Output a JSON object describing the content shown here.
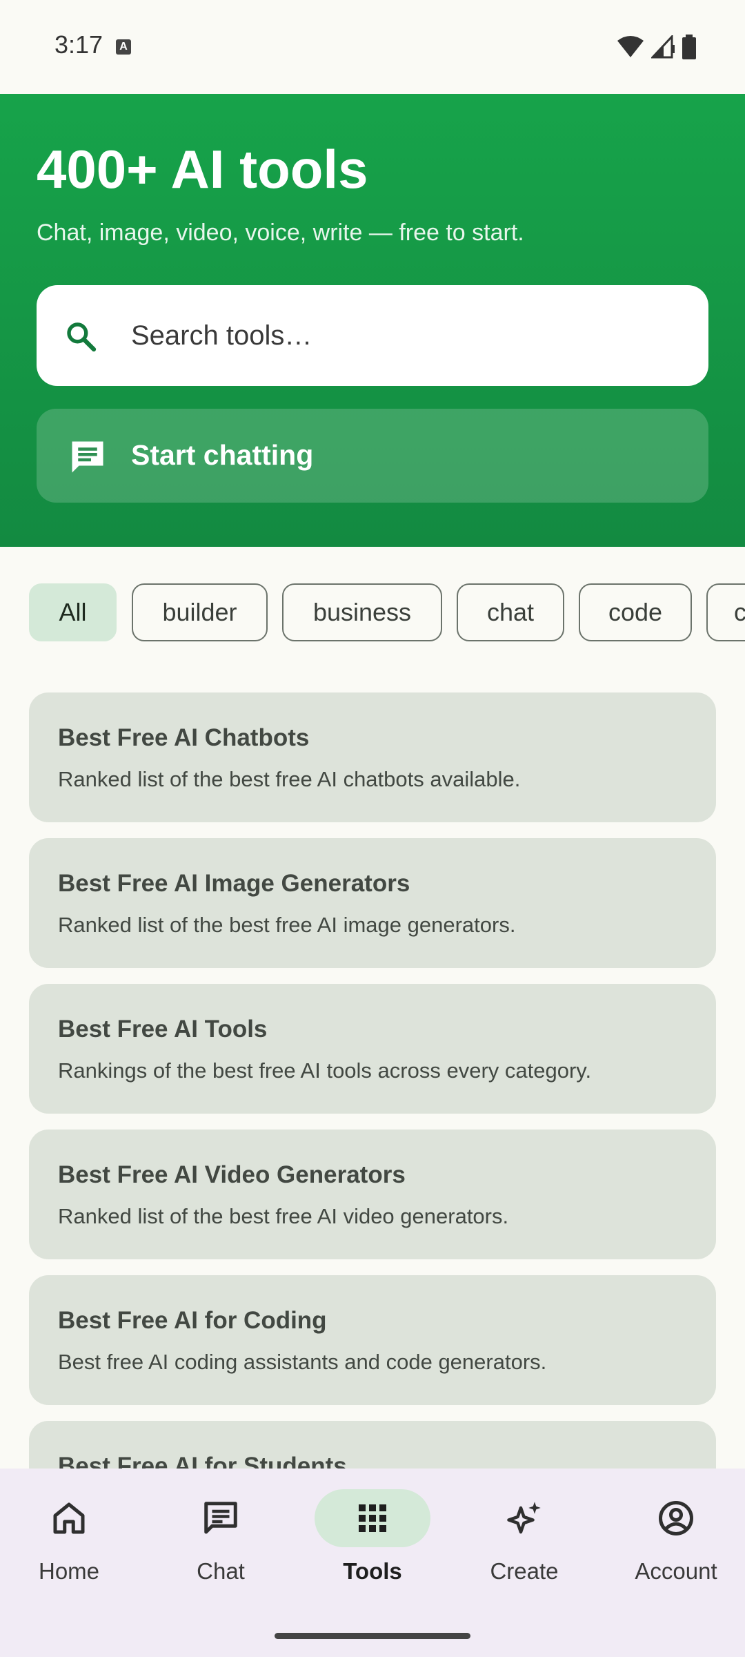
{
  "status_bar": {
    "time": "3:17",
    "notification_letter": "A"
  },
  "hero": {
    "title": "400+ AI tools",
    "subtitle": "Chat, image, video, voice, write — free to start.",
    "search_placeholder": "Search tools…",
    "cta_label": "Start chatting"
  },
  "chips": [
    {
      "label": "All",
      "active": true
    },
    {
      "label": "builder",
      "active": false
    },
    {
      "label": "business",
      "active": false
    },
    {
      "label": "chat",
      "active": false
    },
    {
      "label": "code",
      "active": false
    },
    {
      "label": "c",
      "active": false
    }
  ],
  "cards": [
    {
      "title": "Best Free AI Chatbots",
      "description": "Ranked list of the best free AI chatbots available."
    },
    {
      "title": "Best Free AI Image Generators",
      "description": "Ranked list of the best free AI image generators."
    },
    {
      "title": "Best Free AI Tools",
      "description": "Rankings of the best free AI tools across every category."
    },
    {
      "title": "Best Free AI Video Generators",
      "description": "Ranked list of the best free AI video generators."
    },
    {
      "title": "Best Free AI for Coding",
      "description": "Best free AI coding assistants and code generators."
    },
    {
      "title": "Best Free AI for Students",
      "description": ""
    }
  ],
  "nav": [
    {
      "label": "Home",
      "icon": "home-icon",
      "active": false
    },
    {
      "label": "Chat",
      "icon": "chat-icon",
      "active": false
    },
    {
      "label": "Tools",
      "icon": "grid-icon",
      "active": true
    },
    {
      "label": "Create",
      "icon": "sparkle-icon",
      "active": false
    },
    {
      "label": "Account",
      "icon": "account-icon",
      "active": false
    }
  ],
  "colors": {
    "hero_green": "#17a34a",
    "chip_active_bg": "#d4e9d8",
    "card_bg": "#dde3da",
    "nav_bg": "#f1ebf5"
  }
}
